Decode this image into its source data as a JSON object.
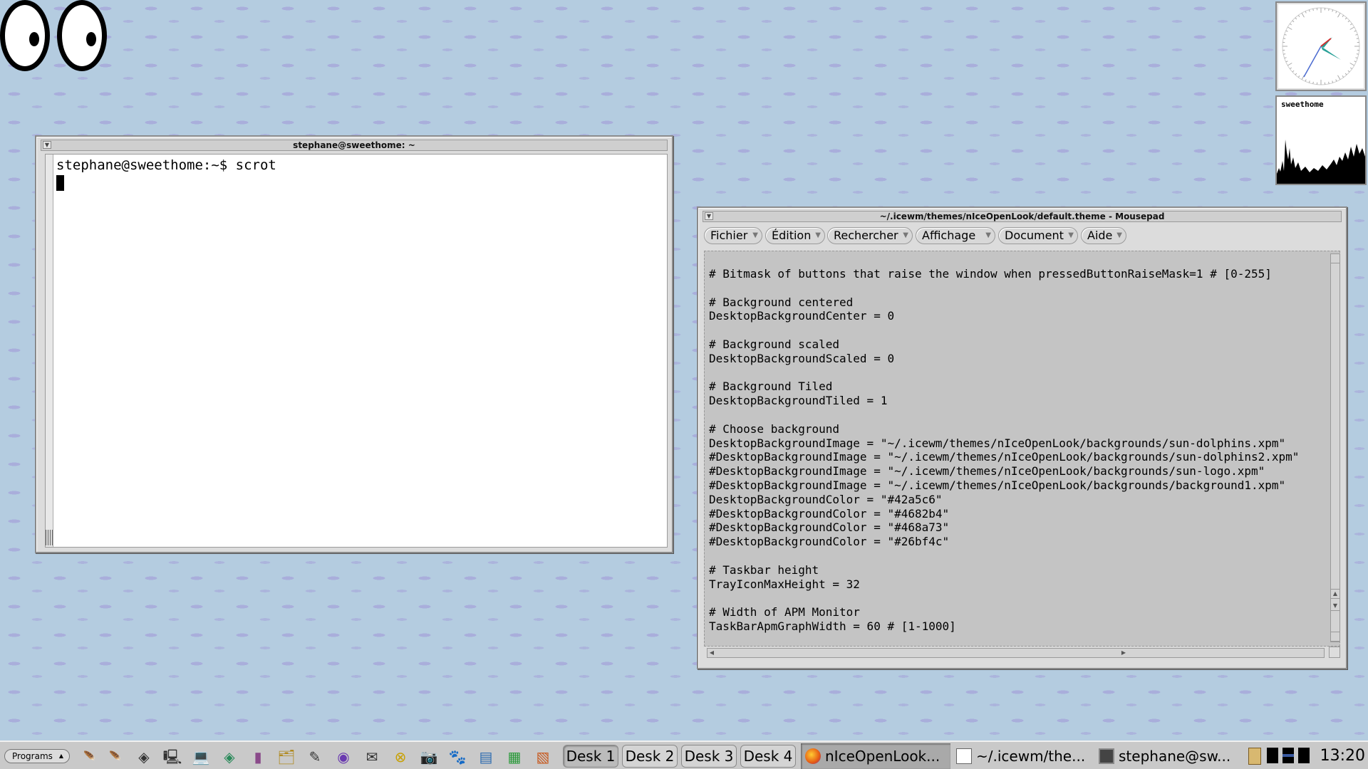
{
  "terminal": {
    "title": "stephane@sweethome: ~",
    "prompt_line": "stephane@sweethome:~$ scrot"
  },
  "mousepad": {
    "title": "~/.icewm/themes/nIceOpenLook/default.theme - Mousepad",
    "menus": [
      "Fichier",
      "Édition",
      "Rechercher",
      "Affichage",
      "Document",
      "Aide"
    ],
    "lines": [
      "# Bitmask of buttons that raise the window when pressedButtonRaiseMask=1 # [0-255]",
      "",
      "# Background centered",
      "DesktopBackgroundCenter = 0",
      "",
      "# Background scaled",
      "DesktopBackgroundScaled = 0",
      "",
      "# Background Tiled",
      "DesktopBackgroundTiled = 1",
      "",
      "# Choose background",
      "DesktopBackgroundImage = \"~/.icewm/themes/nIceOpenLook/backgrounds/sun-dolphins.xpm\"",
      "#DesktopBackgroundImage = \"~/.icewm/themes/nIceOpenLook/backgrounds/sun-dolphins2.xpm\"",
      "#DesktopBackgroundImage = \"~/.icewm/themes/nIceOpenLook/backgrounds/sun-logo.xpm\"",
      "#DesktopBackgroundImage = \"~/.icewm/themes/nIceOpenLook/backgrounds/background1.xpm\"",
      "DesktopBackgroundColor = \"#42a5c6\"",
      "#DesktopBackgroundColor = \"#4682b4\"",
      "#DesktopBackgroundColor = \"#468a73\"",
      "#DesktopBackgroundColor = \"#26bf4c\"",
      "",
      "# Taskbar height",
      "TrayIconMaxHeight = 32",
      "",
      "# Width of APM Monitor",
      "TaskBarApmGraphWidth = 60 # [1-1000]"
    ]
  },
  "sysmon": {
    "label": "sweethome"
  },
  "taskbar": {
    "programs_label": "Programs",
    "quick_launch_icons": [
      "feather-icon",
      "feather-icon",
      "diamond-icon",
      "computer-icon",
      "laptop-icon",
      "diamond-green-icon",
      "book-icon",
      "folders-icon",
      "pen-icon",
      "eye-icon",
      "mailbox-icon",
      "x-icon",
      "camera-icon",
      "gimp-icon",
      "writer-icon",
      "calc-icon",
      "impress-icon"
    ],
    "desks": [
      "Desk 1",
      "Desk 2",
      "Desk 3",
      "Desk 4"
    ],
    "tasks": [
      {
        "label": "nIceOpenLook...",
        "icon": "firefox-icon"
      },
      {
        "label": "~/.icewm/the...",
        "icon": "notepad-icon"
      },
      {
        "label": "stephane@sw...",
        "icon": "terminal-icon"
      }
    ],
    "time": "13:20"
  },
  "colors": {
    "desktop": "#b4cce0",
    "editor_bg": "#c4c4c4",
    "window_frame": "#dcdcdc"
  }
}
